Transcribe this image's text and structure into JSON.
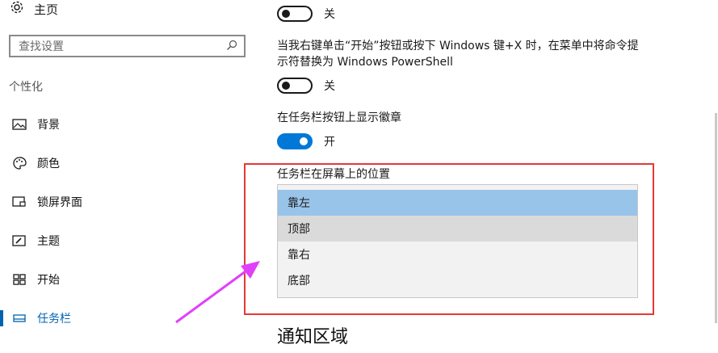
{
  "sidebar": {
    "home_label": "主页",
    "search_placeholder": "查找设置",
    "section_label": "个性化",
    "items": [
      {
        "label": "背景",
        "icon": "image-icon"
      },
      {
        "label": "颜色",
        "icon": "palette-icon"
      },
      {
        "label": "锁屏界面",
        "icon": "lock-screen-icon"
      },
      {
        "label": "主题",
        "icon": "theme-icon"
      },
      {
        "label": "开始",
        "icon": "start-icon"
      },
      {
        "label": "任务栏",
        "icon": "taskbar-icon",
        "active": true
      }
    ]
  },
  "main": {
    "toggle1": {
      "state_label": "关",
      "on": false
    },
    "powershell_desc": "当我右键单击“开始”按钮或按下 Windows 键+X 时，在菜单中将命令提示符替换为 Windows PowerShell",
    "toggle2": {
      "state_label": "关",
      "on": false
    },
    "badges_label": "在任务栏按钮上显示徽章",
    "toggle3": {
      "state_label": "开",
      "on": true
    },
    "position_label": "任务栏在屏幕上的位置",
    "position_options": [
      "靠左",
      "顶部",
      "靠右",
      "底部"
    ],
    "selected_option": "靠左",
    "notification_heading": "通知区域"
  },
  "colors": {
    "accent": "#0078d7",
    "annotation": "#e53935",
    "arrow": "#e040fb"
  }
}
